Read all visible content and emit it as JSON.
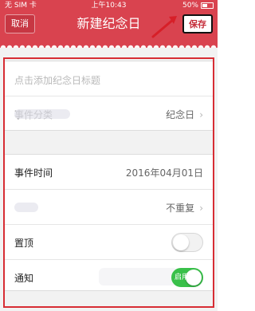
{
  "status": {
    "carrier": "无 SIM 卡",
    "time": "上午10:43",
    "battery": "50%"
  },
  "nav": {
    "cancel": "取消",
    "title": "新建纪念日",
    "save": "保存"
  },
  "form": {
    "title_placeholder": "点击添加纪念日标题",
    "category": {
      "label": "事件分类",
      "value": "纪念日"
    },
    "time": {
      "label": "事件时间",
      "value": "2016年04月01日"
    },
    "repeat": {
      "label": "重复",
      "value": "不重复"
    },
    "pin": {
      "label": "置顶"
    },
    "notify": {
      "label": "通知",
      "switch_text": "启用"
    }
  },
  "colors": {
    "primary": "#d9434f",
    "save_text": "#c62f3c",
    "toggle_on": "#39c04a"
  }
}
